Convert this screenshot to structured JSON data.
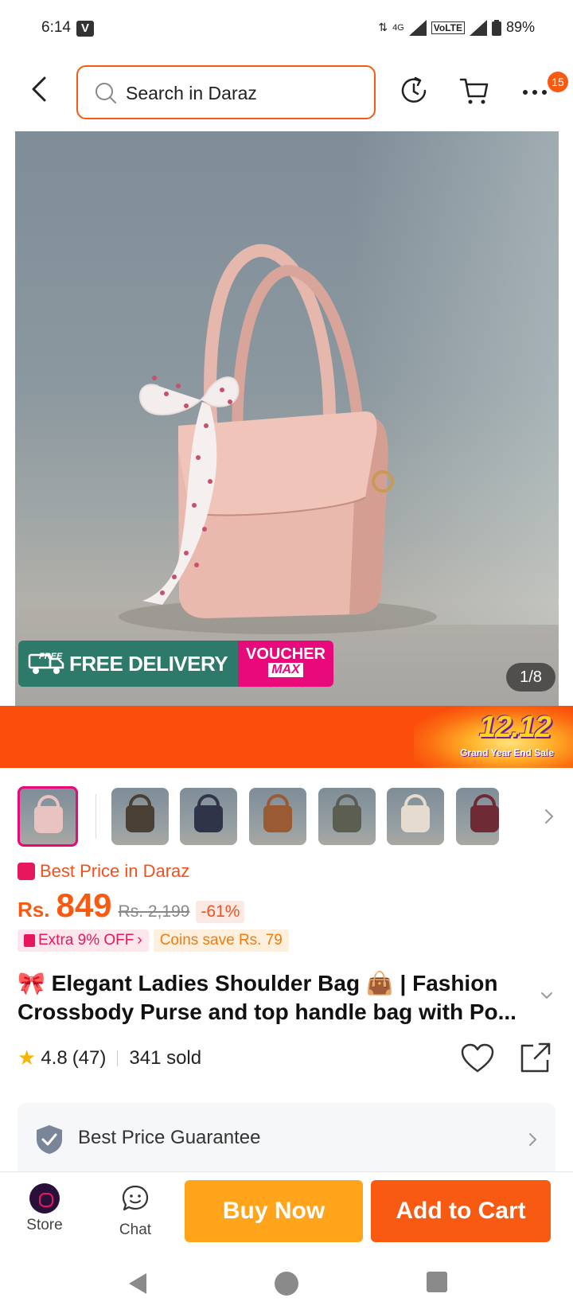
{
  "status_bar": {
    "time": "6:14",
    "carrier_badge": "V",
    "network": "4G",
    "volte": "VoLTE",
    "battery": "89%"
  },
  "header": {
    "search_placeholder": "Search in Daraz",
    "cart_badge": "15"
  },
  "gallery": {
    "counter": "1/8",
    "free_chip": "FREE",
    "delivery_label": "FREE DELIVERY",
    "voucher_line1": "VOUCHER",
    "voucher_line2": "MAX",
    "thumbnail_colors": [
      "#e9c3c0",
      "#4a3f35",
      "#2f3448",
      "#9a5b34",
      "#5d5e52",
      "#e5dccf",
      "#6e2a35"
    ]
  },
  "promo": {
    "title": "12.12",
    "subtitle": "Grand Year End Sale"
  },
  "product": {
    "best_price_label": "Best Price in Daraz",
    "currency": "Rs.",
    "price": "849",
    "original_price": "Rs. 2,199",
    "discount": "-61%",
    "extra_off": "Extra 9% OFF",
    "coins": "Coins save Rs. 79",
    "title_line1": "🎀 Elegant Ladies Shoulder Bag 👜 | Fashion",
    "title_line2": "Crossbody Purse and top handle bag with Po...",
    "rating": "4.8",
    "review_count": "(47)",
    "sold": "341 sold"
  },
  "guarantee": {
    "label": "Best Price Guarantee"
  },
  "bottom_bar": {
    "store_label": "Store",
    "chat_label": "Chat",
    "buy_now": "Buy Now",
    "add_to_cart": "Add to Cart"
  },
  "colors": {
    "accent": "#f85a12",
    "buy_now": "#ffa41b",
    "pink": "#e8097a"
  }
}
